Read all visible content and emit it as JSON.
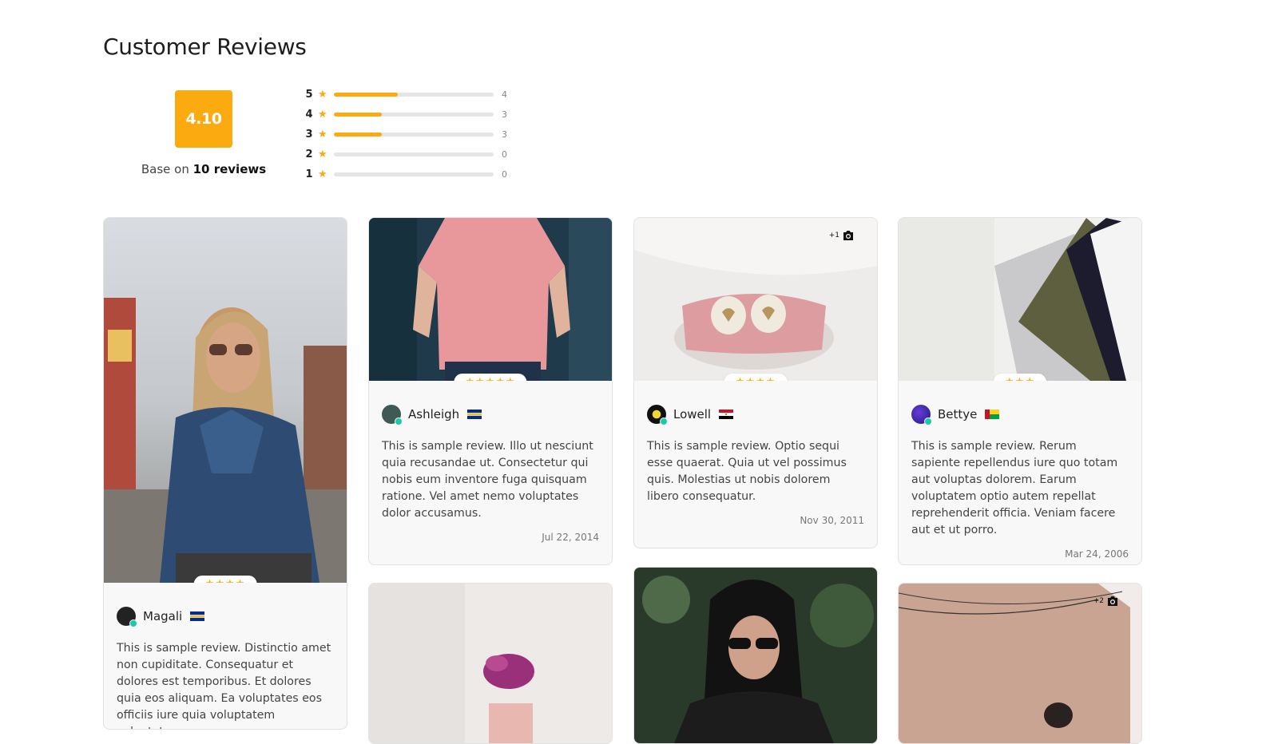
{
  "page": {
    "title": "Customer Reviews"
  },
  "summary": {
    "average": "4.10",
    "base_prefix": "Base on",
    "base_count": "10 reviews",
    "accent_color": "#fbaa10",
    "distribution": [
      {
        "stars": "5",
        "count": "4",
        "fraction": 0.4
      },
      {
        "stars": "4",
        "count": "3",
        "fraction": 0.3
      },
      {
        "stars": "3",
        "count": "3",
        "fraction": 0.3
      },
      {
        "stars": "2",
        "count": "0",
        "fraction": 0
      },
      {
        "stars": "1",
        "count": "0",
        "fraction": 0
      }
    ]
  },
  "reviews": [
    {
      "name": "Magali",
      "rating": 4,
      "stars_text": "★★★★",
      "text": "This is sample review. Distinctio amet non cupiditate. Consequatur et dolores est temporibus. Et dolores quia eos aliquam. Ea voluptates eos officiis iure quia voluptatem voluptates.",
      "date": "",
      "extra_photos": "",
      "photo_subject": "woman-denim-jacket"
    },
    {
      "name": "Ashleigh",
      "rating": 5,
      "stars_text": "★★★★★",
      "text": "This is sample review. Illo ut nesciunt quia recusandae ut. Consectetur qui nobis eum inventore fuga quisquam ratione. Vel amet nemo voluptates dolor accusamus.",
      "date": "Jul 22, 2014",
      "extra_photos": "",
      "photo_subject": "pink-tshirt"
    },
    {
      "name": "Lowell",
      "rating": 4,
      "stars_text": "★★★★",
      "text": "This is sample review. Optio sequi esse quaerat. Quia ut vel possimus quis. Molestias ut nobis dolorem libero consequatur.",
      "date": "Nov 30, 2011",
      "extra_photos": "+1",
      "photo_subject": "baby-clothes"
    },
    {
      "name": "Bettye",
      "rating": 3,
      "stars_text": "★★★",
      "text": "This is sample review. Rerum sapiente repellendus iure quo totam aut voluptas dolorem. Earum voluptatem optio autem repellat reprehenderit officia. Veniam facere aut et ut porro.",
      "date": "Mar 24, 2006",
      "extra_photos": "",
      "photo_subject": "folded-shirts"
    },
    {
      "name": "",
      "rating": null,
      "stars_text": "",
      "text": "",
      "date": "",
      "extra_photos": "",
      "photo_subject": "flower-pot"
    },
    {
      "name": "",
      "rating": null,
      "stars_text": "",
      "text": "",
      "date": "",
      "extra_photos": "",
      "photo_subject": "woman-leather-jacket"
    },
    {
      "name": "",
      "rating": null,
      "stars_text": "",
      "text": "",
      "date": "",
      "extra_photos": "+2",
      "photo_subject": "man-wall"
    }
  ]
}
